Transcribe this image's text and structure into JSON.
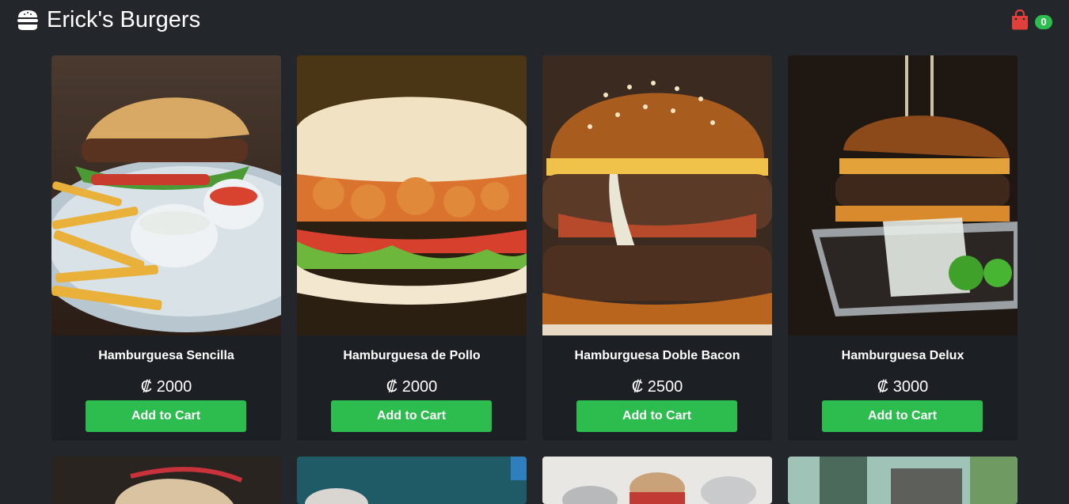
{
  "header": {
    "title": "Erick's Burgers",
    "logo_icon": "burger-icon",
    "cart_icon": "shopping-bag-icon",
    "cart_count": "0",
    "accent_color": "#e0403b",
    "badge_color": "#2dbd4e"
  },
  "products": [
    {
      "name": "Hamburguesa Sencilla",
      "price": "₡ 2000",
      "button": "Add to Cart"
    },
    {
      "name": "Hamburguesa de Pollo",
      "price": "₡ 2000",
      "button": "Add to Cart"
    },
    {
      "name": "Hamburguesa Doble Bacon",
      "price": "₡ 2500",
      "button": "Add to Cart"
    },
    {
      "name": "Hamburguesa Delux",
      "price": "₡ 3000",
      "button": "Add to Cart"
    }
  ],
  "colors": {
    "background": "#23272b",
    "card": "#1c1f23",
    "button": "#2dbd4e"
  }
}
